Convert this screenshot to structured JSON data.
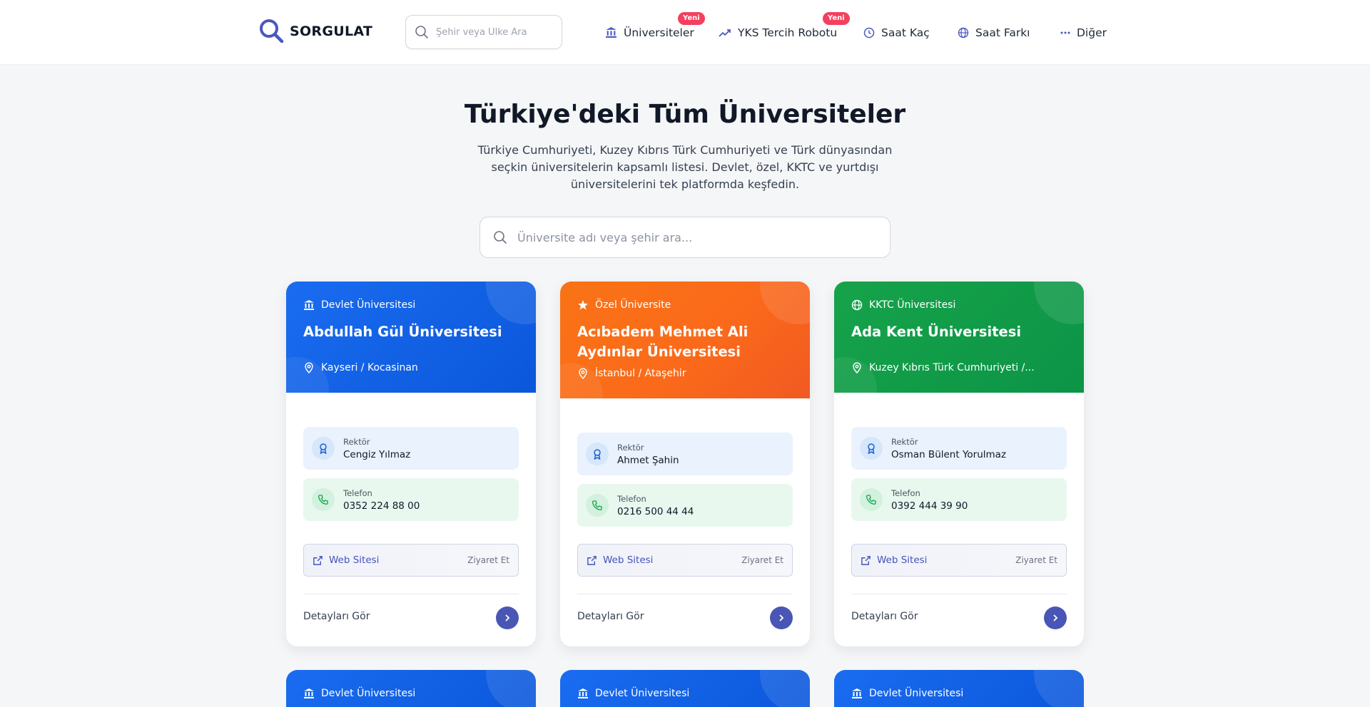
{
  "header": {
    "logo": "SORGULAT",
    "search_placeholder": "Şehir veya Ülke Ara",
    "nav": [
      {
        "label": "Üniversiteler",
        "badge": "Yeni"
      },
      {
        "label": "YKS Tercih Robotu",
        "badge": "Yeni"
      },
      {
        "label": "Saat Kaç"
      },
      {
        "label": "Saat Farkı"
      },
      {
        "label": "Diğer"
      }
    ]
  },
  "hero": {
    "title": "Türkiye'deki Tüm Üniversiteler",
    "description": "Türkiye Cumhuriyeti, Kuzey Kıbrıs Türk Cumhuriyeti ve Türk dünyasından seçkin üniversitelerin kapsamlı listesi. Devlet, özel, KKTC ve yurtdışı üniversitelerini tek platformda keşfedin.",
    "search_placeholder": "Üniversite adı veya şehir ara..."
  },
  "labels": {
    "rector": "Rektör",
    "phone": "Telefon",
    "website": "Web Sitesi",
    "visit": "Ziyaret Et",
    "details": "Detayları Gör"
  },
  "cards": [
    {
      "type": "Devlet Üniversitesi",
      "name": "Abdullah Gül Üniversitesi",
      "location": "Kayseri / Kocasinan",
      "rector": "Cengiz Yılmaz",
      "phone": "0352 224 88 00",
      "color": "#0b5fe3"
    },
    {
      "type": "Özel Üniversite",
      "name": "Acıbadem Mehmet Ali Aydınlar Üniversitesi",
      "location": "İstanbul / Ataşehir",
      "rector": "Ahmet Şahin",
      "phone": "0216 500 44 44",
      "color": "#f97316"
    },
    {
      "type": "KKTC Üniversitesi",
      "name": "Ada Kent Üniversitesi",
      "location": "Kuzey Kıbrıs Türk Cumhuriyeti /...",
      "rector": "Osman Bülent Yorulmaz",
      "phone": "0392 444 39 90",
      "color": "#10a04c"
    }
  ],
  "next_row": [
    {
      "type": "Devlet Üniversitesi"
    },
    {
      "type": "Devlet Üniversitesi"
    },
    {
      "type": "Devlet Üniversitesi"
    }
  ],
  "icons": {
    "logo": "magnifier-logo-icon",
    "state": "bank-icon",
    "private": "star-icon",
    "kktc": "globe-icon",
    "location": "map-pin-icon",
    "rector": "award-icon",
    "phone": "phone-icon",
    "web": "external-link-icon",
    "arrow": "chevron-right-icon"
  }
}
